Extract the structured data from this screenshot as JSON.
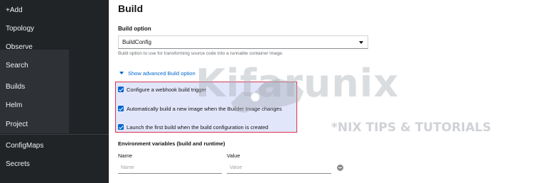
{
  "sidebar": {
    "items": [
      {
        "label": "+Add"
      },
      {
        "label": "Topology"
      },
      {
        "label": "Observe"
      },
      {
        "label": "Search"
      },
      {
        "label": "Builds"
      },
      {
        "label": "Helm"
      },
      {
        "label": "Project"
      },
      {
        "label": "ConfigMaps"
      },
      {
        "label": "Secrets"
      }
    ]
  },
  "page": {
    "title": "Build",
    "build_option": {
      "label": "Build option",
      "selected": "BuildConfig",
      "helper": "Build option to use for transforming source code into a runnable container image."
    },
    "advanced_toggle": "Show advanced Build option",
    "checkboxes": [
      {
        "label": "Configure a webhook build trigger",
        "checked": true
      },
      {
        "label": "Automatically build a new image when the Builder Image changes",
        "checked": true
      },
      {
        "label": "Launch the first build when the build configuration is created",
        "checked": true
      }
    ],
    "env": {
      "title": "Environment variables (build and runtime)",
      "name_header": "Name",
      "value_header": "Value",
      "name_placeholder": "Name",
      "value_placeholder": "Value"
    }
  },
  "watermark": {
    "logo": "Kifarunix",
    "tagline": "*NIX TIPS & TUTORIALS"
  },
  "colors": {
    "sidebar_bg": "#212427",
    "accent": "#0066cc",
    "highlight_border": "#d9334f",
    "highlight_fill": "#cdd5f8"
  }
}
